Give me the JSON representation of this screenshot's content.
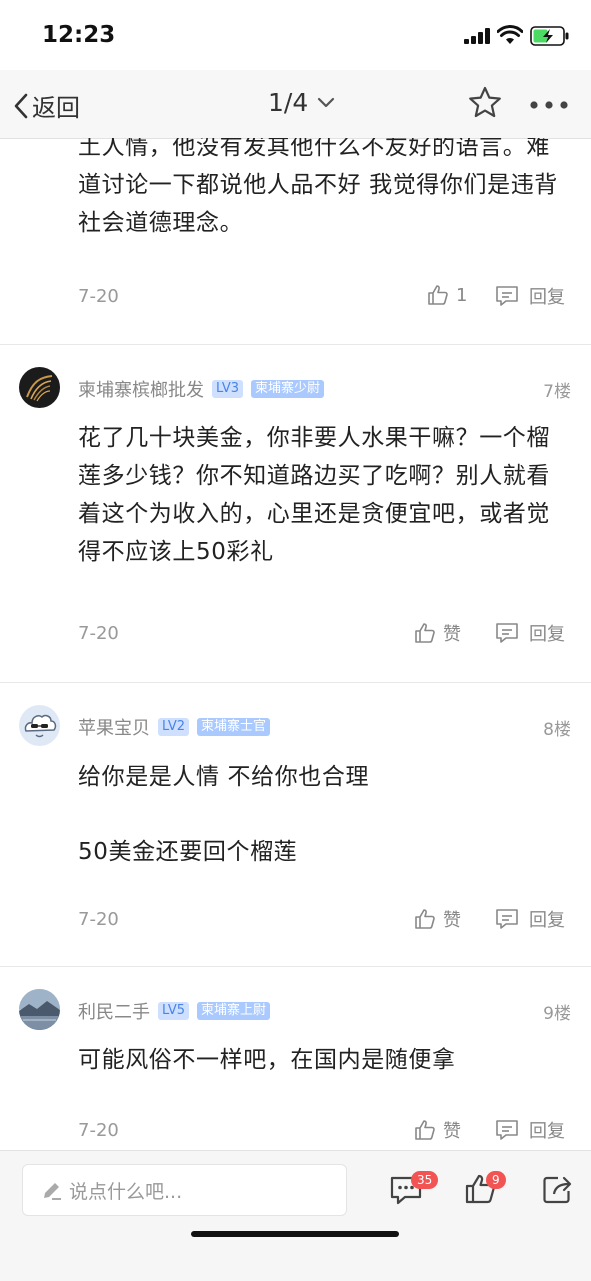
{
  "status": {
    "time": "12:23"
  },
  "nav": {
    "back_label": "返回",
    "page": "1/4"
  },
  "posts": [
    {
      "text": "土人情，他没有发其他什么不友好的语言。难道讨论一下都说他人品不好  我觉得你们是违背社会道德理念。",
      "date": "7-20",
      "likes": "1",
      "reply": "回复"
    },
    {
      "user": "柬埔寨槟榔批发",
      "level": "LV3",
      "rank": "柬埔寨少尉",
      "floor": "7楼",
      "text": "花了几十块美金，你非要人水果干嘛？一个榴莲多少钱？你不知道路边买了吃啊？别人就看着这个为收入的，心里还是贪便宜吧，或者觉得不应该上50彩礼",
      "date": "7-20",
      "like_label": "赞",
      "reply": "回复"
    },
    {
      "user": "苹果宝贝",
      "level": "LV2",
      "rank": "柬埔寨士官",
      "floor": "8楼",
      "text_line1": "给你是是人情 不给你也合理",
      "text_line2": "50美金还要回个榴莲",
      "date": "7-20",
      "like_label": "赞",
      "reply": "回复"
    },
    {
      "user": "利民二手",
      "level": "LV5",
      "rank": "柬埔寨上尉",
      "floor": "9楼",
      "text": "可能风俗不一样吧，在国内是随便拿",
      "date": "7-20",
      "like_label": "赞",
      "reply": "回复"
    }
  ],
  "bottom": {
    "placeholder": "说点什么吧...",
    "comment_count": "35",
    "like_count": "9"
  }
}
